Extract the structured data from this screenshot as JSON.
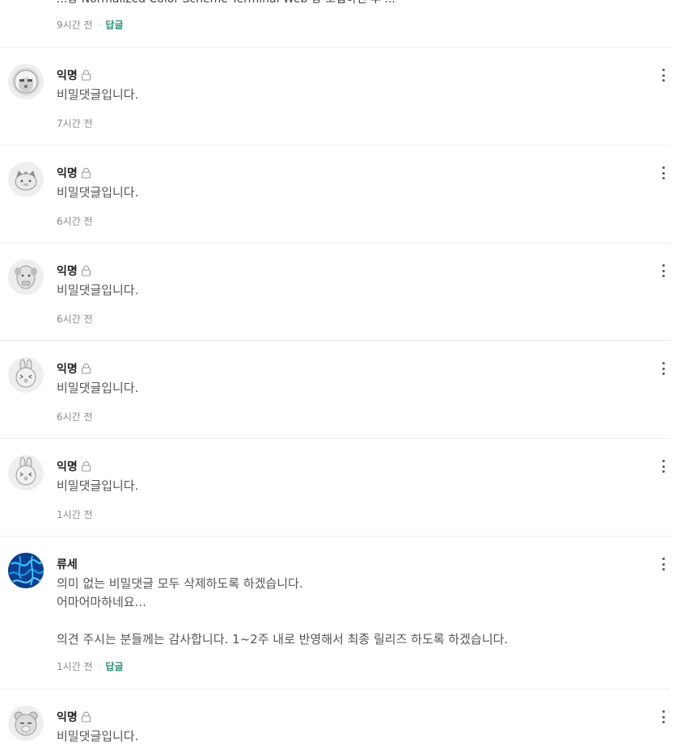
{
  "top": {
    "text": "...용 Normalized Color Scheme Terminal Web 등 도입하신 후 ...",
    "time": "9시간 전",
    "separator": "·",
    "reply": "답글"
  },
  "comments": [
    {
      "author": "익명",
      "secret": true,
      "body": "비밀댓글입니다.",
      "time": "7시간 전",
      "avatar": "ryan-afro-icon"
    },
    {
      "author": "익명",
      "secret": true,
      "body": "비밀댓글입니다.",
      "time": "6시간 전",
      "avatar": "cat-character-icon"
    },
    {
      "author": "익명",
      "secret": true,
      "body": "비밀댓글입니다.",
      "time": "6시간 전",
      "avatar": "dog-character-icon"
    },
    {
      "author": "익명",
      "secret": true,
      "body": "비밀댓글입니다.",
      "time": "6시간 전",
      "avatar": "rabbit-character-icon"
    },
    {
      "author": "익명",
      "secret": true,
      "body": "비밀댓글입니다.",
      "time": "1시간 전",
      "avatar": "rabbit-character-icon"
    },
    {
      "author": "류세",
      "secret": false,
      "body": "의미 없는 비밀댓글 모두 삭제하도록 하겠습니다.\n어마어마하네요...\n\n의견 주시는 분들께는 감사합니다. 1~2주 내로 반영해서 최종 릴리즈 하도록 하겠습니다.",
      "time": "1시간 전",
      "separator": "·",
      "reply": "답글",
      "avatar": "blue-abstract-avatar"
    },
    {
      "author": "익명",
      "secret": true,
      "body": "비밀댓글입니다.",
      "avatar": "ryan-bear-icon"
    }
  ],
  "colors": {
    "reply_link": "#2d8f7b",
    "avatar_bg": "#eeeeee",
    "divider": "#ededed"
  }
}
